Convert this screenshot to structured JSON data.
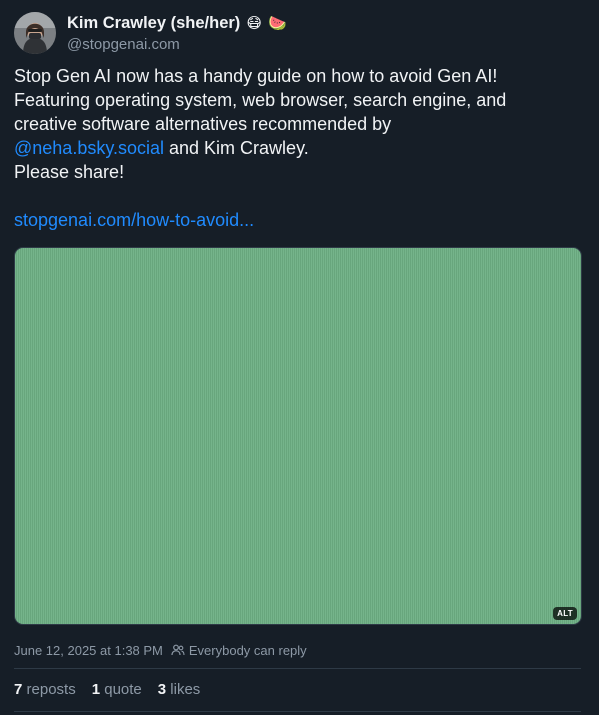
{
  "author": {
    "display_name": "Kim Crawley (she/her)",
    "emojis": [
      "😷",
      "🍉"
    ],
    "handle": "@stopgenai.com",
    "avatar_icon": "avatar-photo"
  },
  "post": {
    "line1": "Stop Gen AI now has a handy guide on how to avoid Gen AI!",
    "line2": "Featuring operating system, web browser, search engine, and",
    "line3": "creative software alternatives recommended by",
    "mention": "@neha.bsky.social",
    "line4_rest": " and Kim Crawley.",
    "line5": "Please share!",
    "link": "stopgenai.com/how-to-avoid..."
  },
  "image": {
    "alt_badge": "ALT",
    "fill_color": "#6eb085"
  },
  "meta": {
    "timestamp": "June 12, 2025 at 1:38 PM",
    "reply_setting": "Everybody can reply",
    "reply_icon": "people-icon"
  },
  "stats": {
    "reposts_count": "7",
    "reposts_label": "reposts",
    "quotes_count": "1",
    "quotes_label": "quote",
    "likes_count": "3",
    "likes_label": "likes"
  },
  "colors": {
    "background": "#161e27",
    "text": "#f1f3f5",
    "muted": "#8d99a6",
    "link": "#208bfe"
  }
}
